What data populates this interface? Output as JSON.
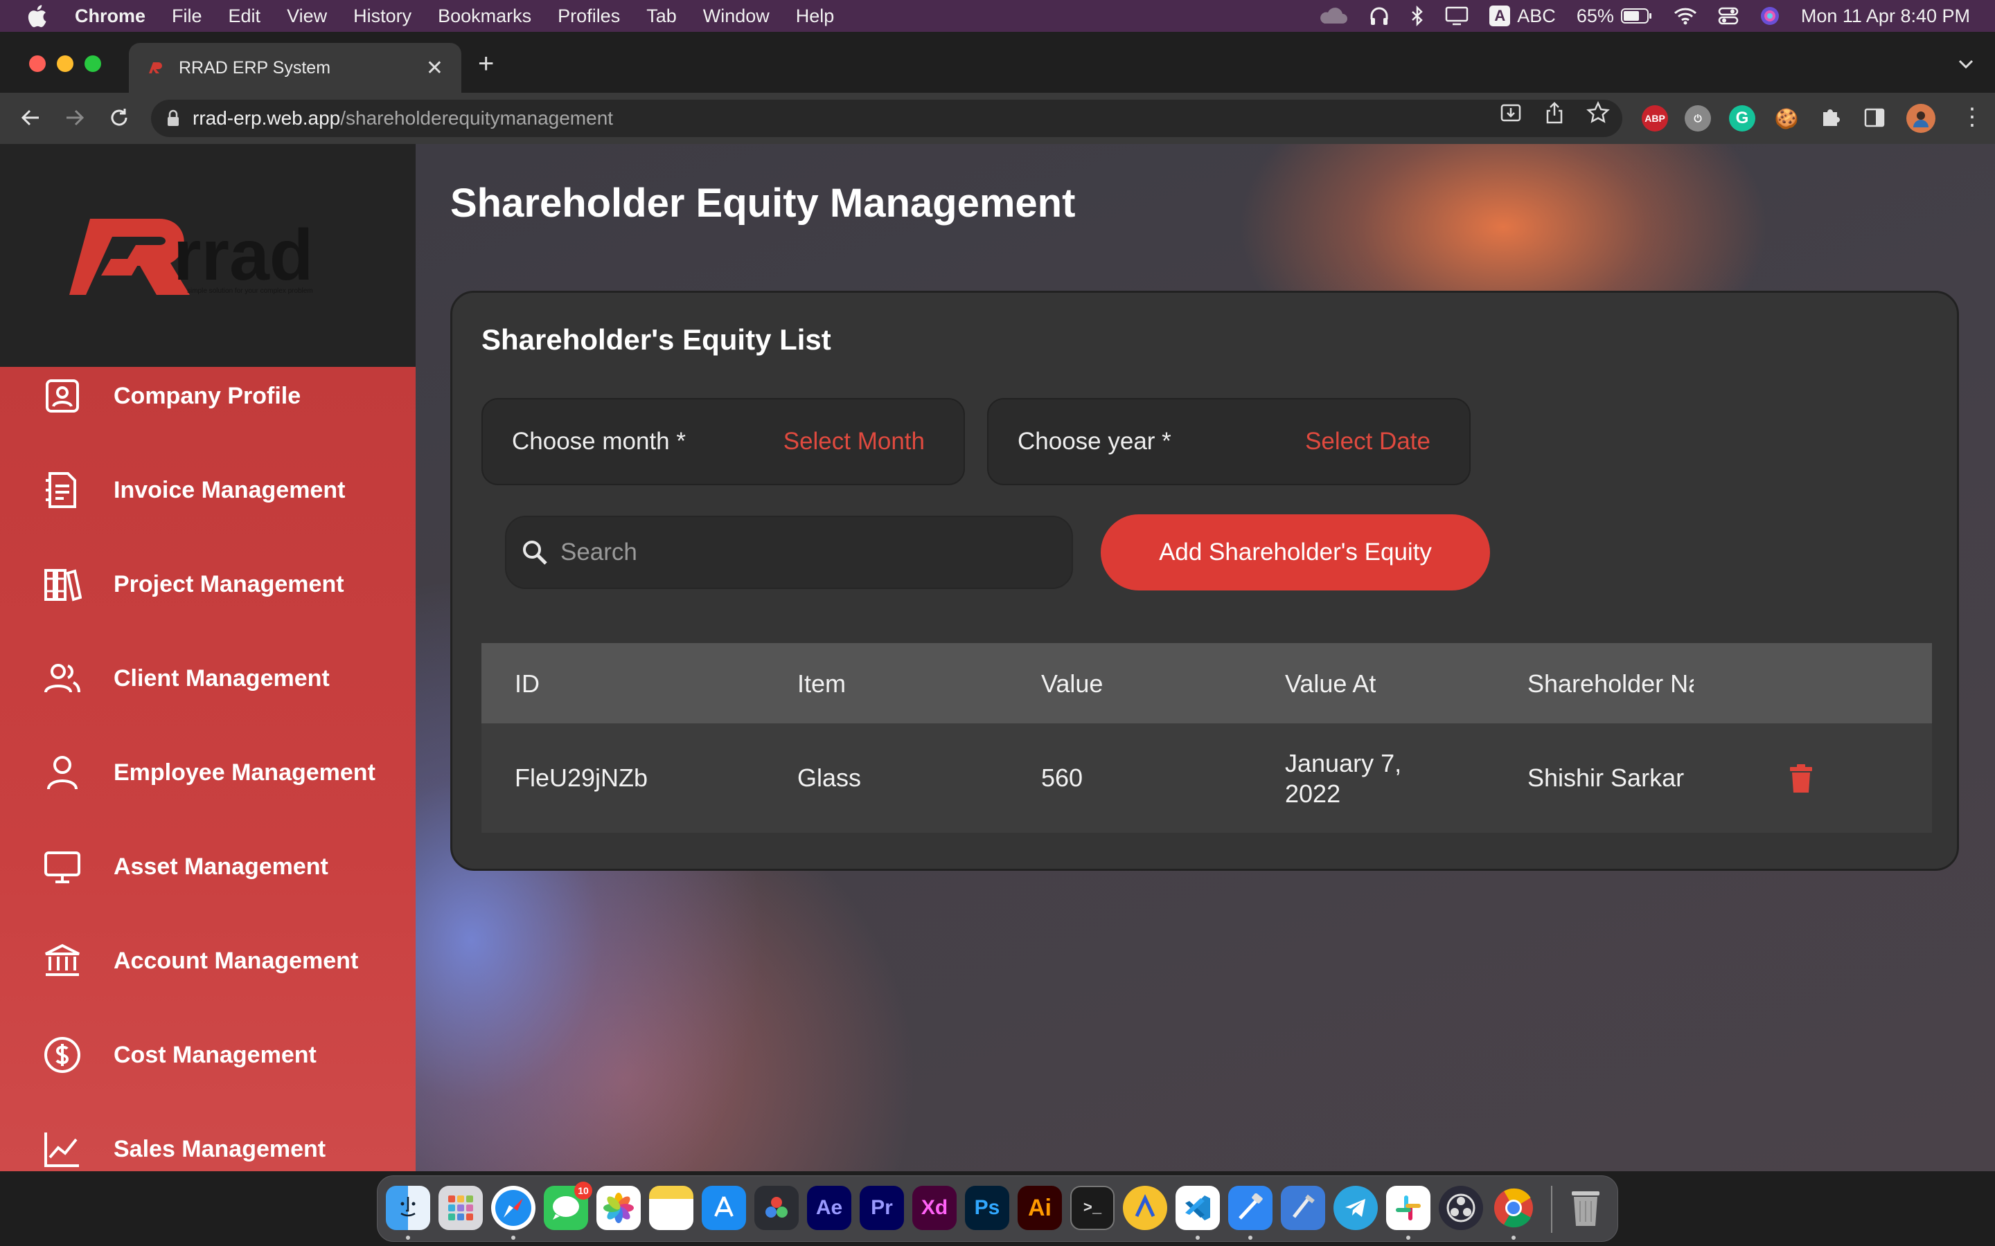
{
  "menubar": {
    "app": "Chrome",
    "items": [
      "File",
      "Edit",
      "View",
      "History",
      "Bookmarks",
      "Profiles",
      "Tab",
      "Window",
      "Help"
    ],
    "input_source": "ABC",
    "input_source_letter": "A",
    "battery": "65%",
    "datetime": "Mon 11 Apr  8:40 PM"
  },
  "browser": {
    "tab_title": "RRAD ERP System",
    "url_host": "rrad-erp.web.app",
    "url_path": "/shareholderequitymanagement",
    "extensions": [
      "ABP"
    ]
  },
  "sidebar": {
    "logo_text": "rrad",
    "logo_tagline": "simple solution for your complex problem",
    "items": [
      {
        "label": "Company Profile",
        "icon": "id-badge-icon"
      },
      {
        "label": "Invoice Management",
        "icon": "receipt-icon"
      },
      {
        "label": "Project Management",
        "icon": "books-icon"
      },
      {
        "label": "Client Management",
        "icon": "users-icon"
      },
      {
        "label": "Employee Management",
        "icon": "user-icon"
      },
      {
        "label": "Asset Management",
        "icon": "monitor-icon"
      },
      {
        "label": "Account Management",
        "icon": "bank-icon"
      },
      {
        "label": "Cost Management",
        "icon": "dollar-circle-icon"
      },
      {
        "label": "Sales Management",
        "icon": "chart-line-icon"
      }
    ]
  },
  "main": {
    "title": "Shareholder Equity Management",
    "card_title": "Shareholder's Equity List",
    "month_picker": {
      "label": "Choose month *",
      "value": "Select Month"
    },
    "year_picker": {
      "label": "Choose year *",
      "value": "Select Date"
    },
    "search": {
      "placeholder": "Search"
    },
    "add_button": "Add Shareholder's Equity",
    "table": {
      "headers": [
        "ID",
        "Item",
        "Value",
        "Value At",
        "Shareholder Name"
      ],
      "rows": [
        {
          "id": "FleU29jNZb",
          "item": "Glass",
          "value": "560",
          "value_at": "January 7, 2022",
          "shareholder": "Shishir Sarkar"
        }
      ]
    }
  },
  "dock": {
    "apps": [
      "Finder",
      "Launchpad",
      "Safari",
      "Messages",
      "Photos",
      "Notes",
      "App Store",
      "DaVinci Resolve",
      "After Effects",
      "Premiere Pro",
      "Adobe XD",
      "Photoshop",
      "Illustrator",
      "Terminal",
      "Weather",
      "VS Code",
      "Xcode",
      "Instruments",
      "Telegram",
      "Slack",
      "OBS",
      "Chrome",
      "Trash"
    ],
    "labels": {
      "ae": "Ae",
      "pr": "Pr",
      "xd": "Xd",
      "ps": "Ps",
      "ai": "Ai"
    },
    "messages_badge": "10"
  },
  "colors": {
    "accent": "#dc3b35",
    "sidebar_red": "#c94040",
    "card_bg": "#353535",
    "picker_value": "#e04a3f"
  }
}
